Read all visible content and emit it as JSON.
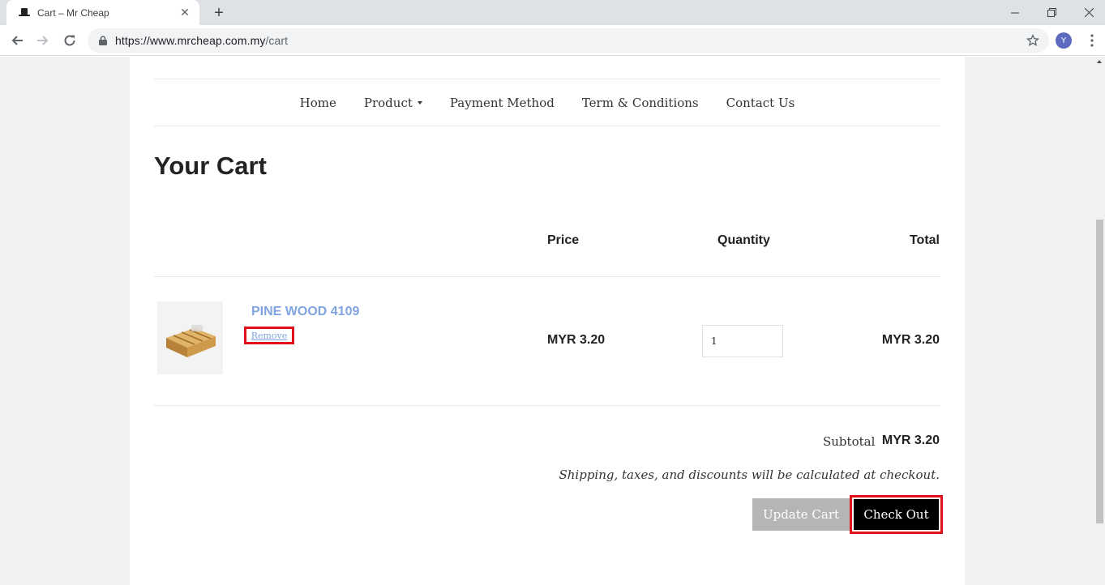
{
  "browser": {
    "tab_title": "Cart – Mr Cheap",
    "url_host": "https://www.mrcheap.com.my",
    "url_path": "/cart",
    "avatar_initial": "Y"
  },
  "nav": {
    "items": [
      {
        "label": "Home"
      },
      {
        "label": "Product"
      },
      {
        "label": "Payment Method"
      },
      {
        "label": "Term & Conditions"
      },
      {
        "label": "Contact Us"
      }
    ]
  },
  "cart": {
    "title": "Your Cart",
    "headers": {
      "price": "Price",
      "quantity": "Quantity",
      "total": "Total"
    },
    "items": [
      {
        "name": "PINE WOOD 4109",
        "remove_label": "Remove",
        "price": "MYR 3.20",
        "quantity": "1",
        "total": "MYR 3.20"
      }
    ],
    "subtotal_label": "Subtotal",
    "subtotal_value": "MYR 3.20",
    "note": "Shipping, taxes, and discounts will be calculated at checkout.",
    "update_label": "Update Cart",
    "checkout_label": "Check Out"
  },
  "colors": {
    "link": "#7fa4e0",
    "highlight": "#e0101a",
    "checkout_bg": "#000000",
    "update_bg": "#b5b5b5"
  }
}
